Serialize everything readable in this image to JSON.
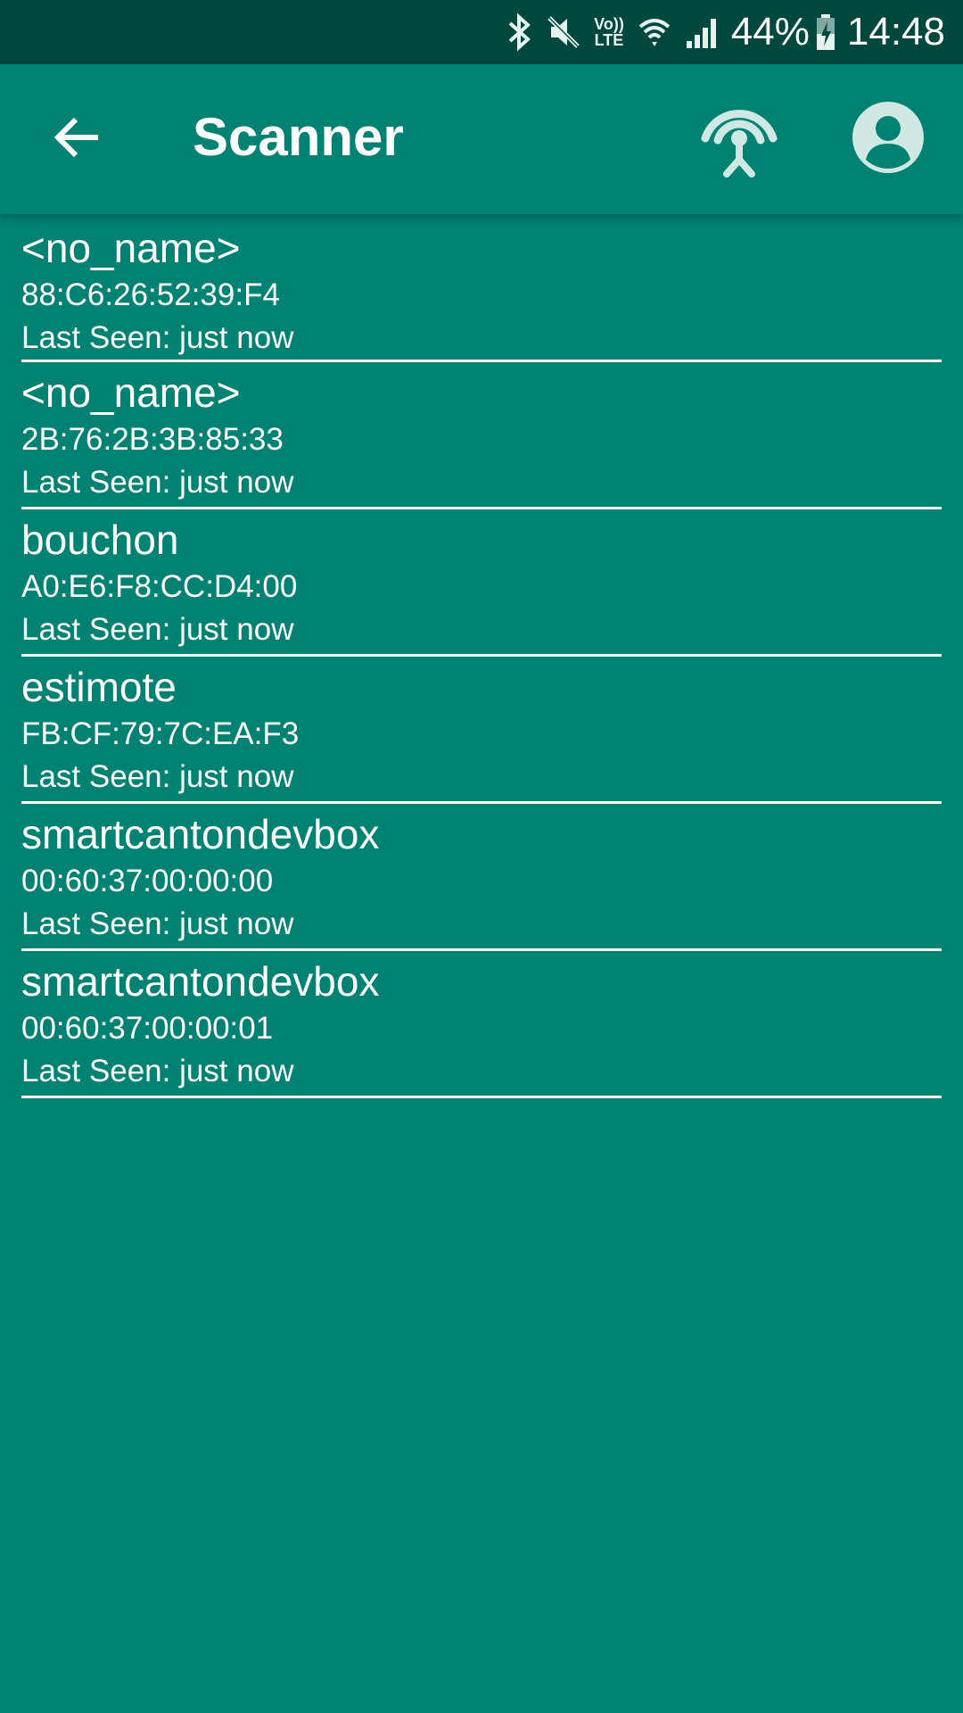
{
  "status_bar": {
    "icons": [
      "bluetooth-icon",
      "mute-icon",
      "volte-icon",
      "wifi-icon",
      "signal-icon",
      "battery-icon"
    ],
    "volte_label_top": "Vo))",
    "volte_label_bottom": "LTE",
    "battery_percent": "44%",
    "time": "14:48"
  },
  "app_bar": {
    "title": "Scanner",
    "back_icon": "arrow-left-icon",
    "beacon_icon": "broadcast-antenna-icon",
    "account_icon": "account-circle-icon"
  },
  "devices": [
    {
      "name": "<no_name>",
      "mac": "88:C6:26:52:39:F4",
      "last_seen": "Last Seen: just now"
    },
    {
      "name": "<no_name>",
      "mac": "2B:76:2B:3B:85:33",
      "last_seen": "Last Seen: just now"
    },
    {
      "name": "bouchon",
      "mac": "A0:E6:F8:CC:D4:00",
      "last_seen": "Last Seen: just now"
    },
    {
      "name": "estimote",
      "mac": "FB:CF:79:7C:EA:F3",
      "last_seen": "Last Seen: just now"
    },
    {
      "name": "smartcantondevbox",
      "mac": "00:60:37:00:00:00",
      "last_seen": "Last Seen: just now"
    },
    {
      "name": "smartcantondevbox",
      "mac": "00:60:37:00:00:01",
      "last_seen": "Last Seen: just now"
    }
  ],
  "colors": {
    "background": "#008272",
    "status_bar": "#00473d",
    "text": "#ffffff",
    "icon_tint": "#cfe8e3"
  }
}
